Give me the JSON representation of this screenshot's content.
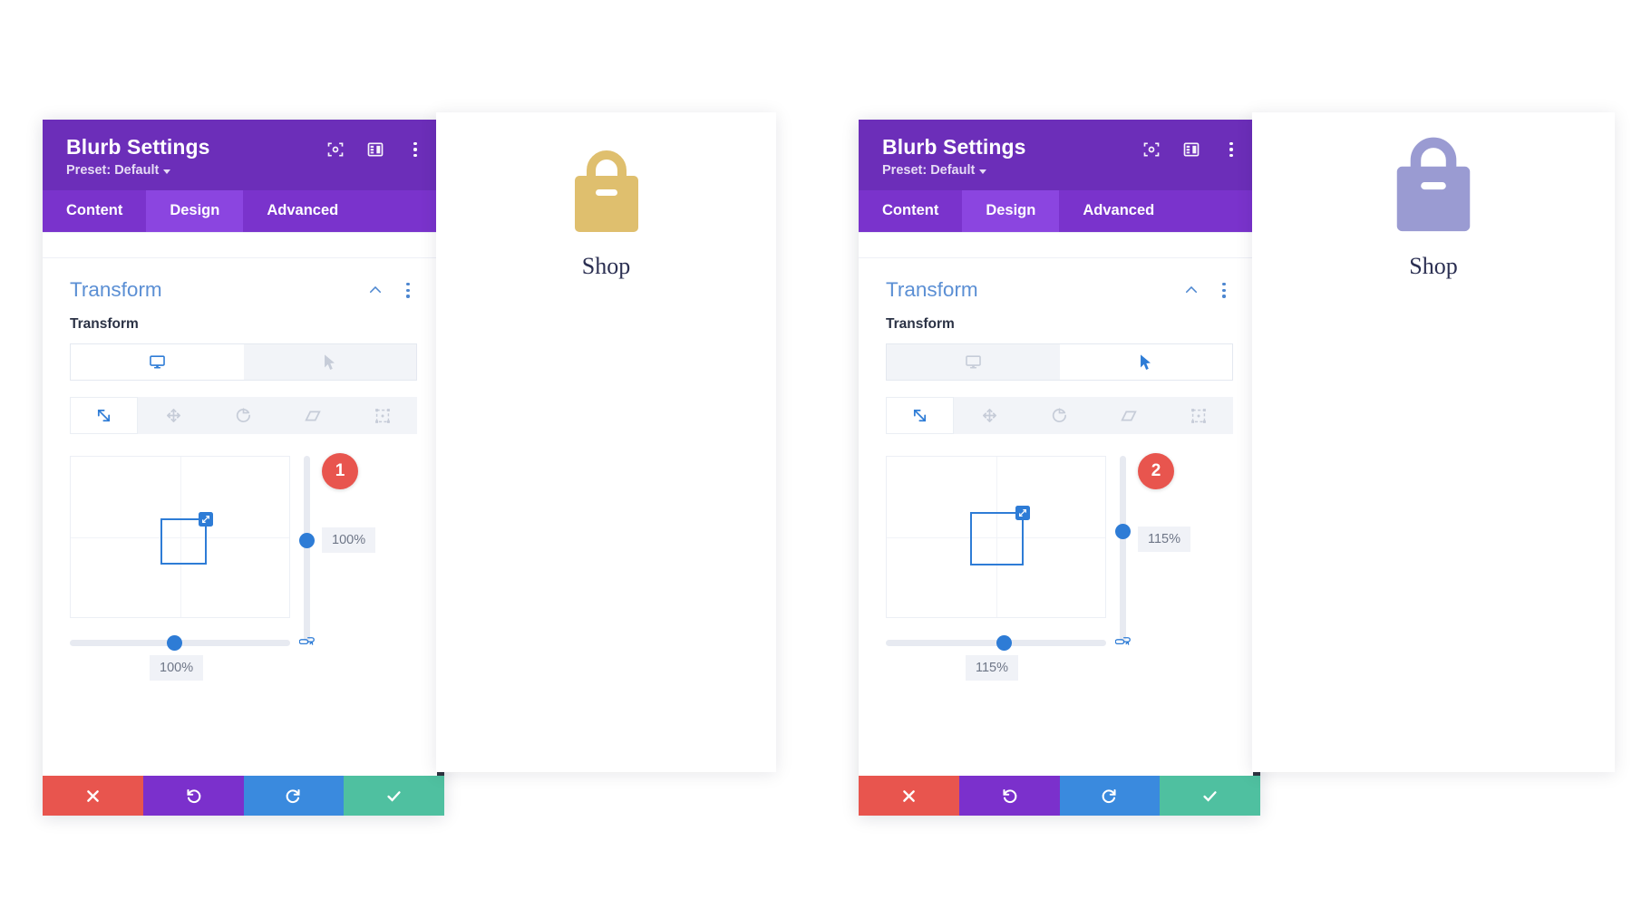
{
  "canvas": {
    "background": "#ffffff"
  },
  "panels": [
    {
      "id": "before",
      "modal": {
        "title": "Blurb Settings",
        "preset_label": "Preset: Default",
        "header_icons": [
          "focus-frame-icon",
          "layout-columns-icon",
          "more-vertical-icon"
        ],
        "tabs": [
          {
            "label": "Content",
            "active": false
          },
          {
            "label": "Design",
            "active": true
          },
          {
            "label": "Advanced",
            "active": false
          }
        ],
        "section": {
          "title": "Transform",
          "collapse_icon": "chevron-up-icon",
          "options_icon": "more-vertical-icon",
          "field_label": "Transform",
          "device_toggle": [
            {
              "icon": "desktop-icon",
              "active": true
            },
            {
              "icon": "cursor-pointer-icon",
              "active": false
            }
          ],
          "tools": [
            {
              "icon": "scale-icon",
              "active": true
            },
            {
              "icon": "move-icon",
              "active": false
            },
            {
              "icon": "rotate-icon",
              "active": false
            },
            {
              "icon": "skew-icon",
              "active": false
            },
            {
              "icon": "origin-icon",
              "active": false
            }
          ],
          "scale_y_value": "100%",
          "scale_x_value": "100%",
          "link_icon": "link-axes-icon"
        },
        "footer": [
          {
            "name": "close",
            "icon": "close-icon",
            "color": "#e8554e"
          },
          {
            "name": "undo",
            "icon": "undo-icon",
            "color": "#7b30cc"
          },
          {
            "name": "redo",
            "icon": "redo-icon",
            "color": "#3a8ade"
          },
          {
            "name": "save",
            "icon": "check-icon",
            "color": "#4fc0a0"
          }
        ]
      },
      "callout": {
        "number": "1",
        "color": "#e8554e"
      },
      "preview": {
        "icon": "shopping-bag-icon",
        "icon_color": "#dfbf6e",
        "icon_scale_percent": 100,
        "title": "Shop"
      }
    },
    {
      "id": "after",
      "modal": {
        "title": "Blurb Settings",
        "preset_label": "Preset: Default",
        "header_icons": [
          "focus-frame-icon",
          "layout-columns-icon",
          "more-vertical-icon"
        ],
        "tabs": [
          {
            "label": "Content",
            "active": false
          },
          {
            "label": "Design",
            "active": true
          },
          {
            "label": "Advanced",
            "active": false
          }
        ],
        "section": {
          "title": "Transform",
          "collapse_icon": "chevron-up-icon",
          "options_icon": "more-vertical-icon",
          "field_label": "Transform",
          "device_toggle": [
            {
              "icon": "desktop-icon",
              "active": false
            },
            {
              "icon": "cursor-pointer-icon",
              "active": true
            }
          ],
          "tools": [
            {
              "icon": "scale-icon",
              "active": true
            },
            {
              "icon": "move-icon",
              "active": false
            },
            {
              "icon": "rotate-icon",
              "active": false
            },
            {
              "icon": "skew-icon",
              "active": false
            },
            {
              "icon": "origin-icon",
              "active": false
            }
          ],
          "scale_y_value": "115%",
          "scale_x_value": "115%",
          "link_icon": "link-axes-icon"
        },
        "footer": [
          {
            "name": "close",
            "icon": "close-icon",
            "color": "#e8554e"
          },
          {
            "name": "undo",
            "icon": "undo-icon",
            "color": "#7b30cc"
          },
          {
            "name": "redo",
            "icon": "redo-icon",
            "color": "#3a8ade"
          },
          {
            "name": "save",
            "icon": "check-icon",
            "color": "#4fc0a0"
          }
        ]
      },
      "callout": {
        "number": "2",
        "color": "#e8554e"
      },
      "preview": {
        "icon": "shopping-bag-icon",
        "icon_color": "#9a9bd2",
        "icon_scale_percent": 115,
        "title": "Shop"
      }
    }
  ],
  "theme": {
    "header_purple": "#6c2eb9",
    "tabbar_purple": "#7a33cc",
    "tab_active_purple": "#8b45e0",
    "accent_blue": "#2e7cd6",
    "section_title_blue": "#5b8fd4"
  }
}
